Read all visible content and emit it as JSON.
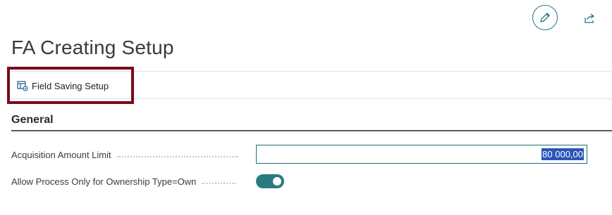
{
  "page": {
    "title": "FA Creating Setup"
  },
  "header_actions": {
    "edit_icon": "pencil-icon",
    "share_icon": "share-icon"
  },
  "action_bar": {
    "field_saving_setup_label": "Field Saving Setup",
    "field_saving_setup_icon": "setup-grid-icon"
  },
  "general": {
    "title": "General",
    "fields": [
      {
        "label": "Acquisition Amount Limit",
        "value": "80 000,00",
        "value_selected": true
      },
      {
        "label": "Allow Process Only for Ownership Type=Own",
        "toggle_on": true
      }
    ]
  },
  "colors": {
    "accent": "#2a7b80",
    "highlight_border": "#7a0a1e",
    "selection": "#2a56b8"
  }
}
